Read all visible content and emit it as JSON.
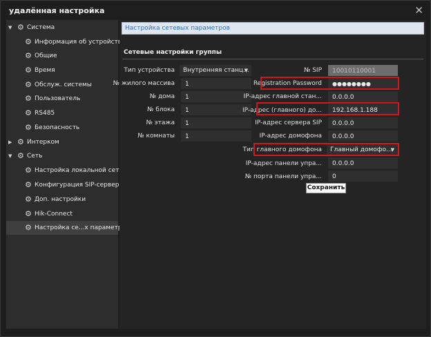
{
  "window": {
    "title": "удалённая настройка",
    "close_icon": "close-icon"
  },
  "sidebar": {
    "items": [
      {
        "label": "Система",
        "type": "group",
        "expanded": true
      },
      {
        "label": "Информация об устройстве:"
      },
      {
        "label": "Общие"
      },
      {
        "label": "Время"
      },
      {
        "label": "Обслуж. системы"
      },
      {
        "label": "Пользователь"
      },
      {
        "label": "RS485"
      },
      {
        "label": "Безопасность"
      },
      {
        "label": "Интерком",
        "type": "group",
        "expanded": false
      },
      {
        "label": "Сеть",
        "type": "group",
        "expanded": true
      },
      {
        "label": "Настройка локальной сети"
      },
      {
        "label": "Конфигурация SIP-сервера"
      },
      {
        "label": "Доп. настройки"
      },
      {
        "label": "Hik-Connect"
      },
      {
        "label": "Настройка се...х параметров",
        "selected": true
      }
    ]
  },
  "main": {
    "header": "Настройка сетевых параметров",
    "section_title": "Сетевые настройки группы",
    "left_fields": [
      {
        "label": "Тип устройства",
        "value": "Внутренняя станц...",
        "kind": "select"
      },
      {
        "label": "№ жилого массива",
        "value": "1"
      },
      {
        "label": "№ дома",
        "value": "1"
      },
      {
        "label": "№ блока",
        "value": "1"
      },
      {
        "label": "№ этажа",
        "value": "1"
      },
      {
        "label": "№ комнаты",
        "value": "1"
      }
    ],
    "right_fields": [
      {
        "label": "№ SIP",
        "value": "10010110001",
        "kind": "disabled"
      },
      {
        "label": "Registration Password",
        "value": "●●●●●●●●",
        "kind": "password"
      },
      {
        "label": "IP-адрес главной стан...",
        "value": "0.0.0.0"
      },
      {
        "label": "IP-адрес (главного) до...",
        "value": "192.168.1.188"
      },
      {
        "label": "IP-адрес сервера SIP",
        "value": "0.0.0.0"
      },
      {
        "label": "IP-адрес домофона",
        "value": "0.0.0.0"
      },
      {
        "label": "Тип главного домофона",
        "value": "Главный домофо...",
        "kind": "select"
      },
      {
        "label": "IP-адрес панели упра...",
        "value": "0.0.0.0"
      },
      {
        "label": "№ порта панели упра...",
        "value": "0"
      }
    ],
    "save_label": "Сохранить"
  },
  "colors": {
    "highlight": "#d8141c",
    "header_text": "#3b6fb6",
    "background": "#1e1e1e"
  }
}
